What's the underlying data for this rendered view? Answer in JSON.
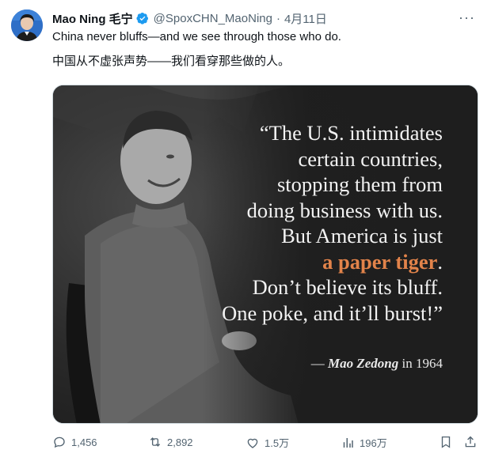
{
  "tweet": {
    "author_name": "Mao Ning 毛宁",
    "handle": "@SpoxCHN_MaoNing",
    "separator": "·",
    "date": "4月11日",
    "text_en": "China never bluffs—and we see through those who do.",
    "text_zh": "中国从不虚张声势——我们看穿那些做的人。"
  },
  "image": {
    "quote_lines": [
      "“The U.S. intimidates",
      "certain countries,",
      "stopping them from",
      "doing business with us.",
      "But America is just"
    ],
    "highlight": "a paper tiger",
    "highlight_tail": ".",
    "quote_lines_after": [
      "Don’t believe its bluff.",
      "One poke, and it’ll burst!”"
    ],
    "attribution_dash": "— ",
    "attribution_name": "Mao Zedong",
    "attribution_year": " in 1964",
    "highlight_color": "#e2834a"
  },
  "actions": {
    "replies": "1,456",
    "reposts": "2,892",
    "likes": "1.5万",
    "views": "196万"
  },
  "colors": {
    "verified": "#1d9bf0",
    "muted": "#536471"
  }
}
